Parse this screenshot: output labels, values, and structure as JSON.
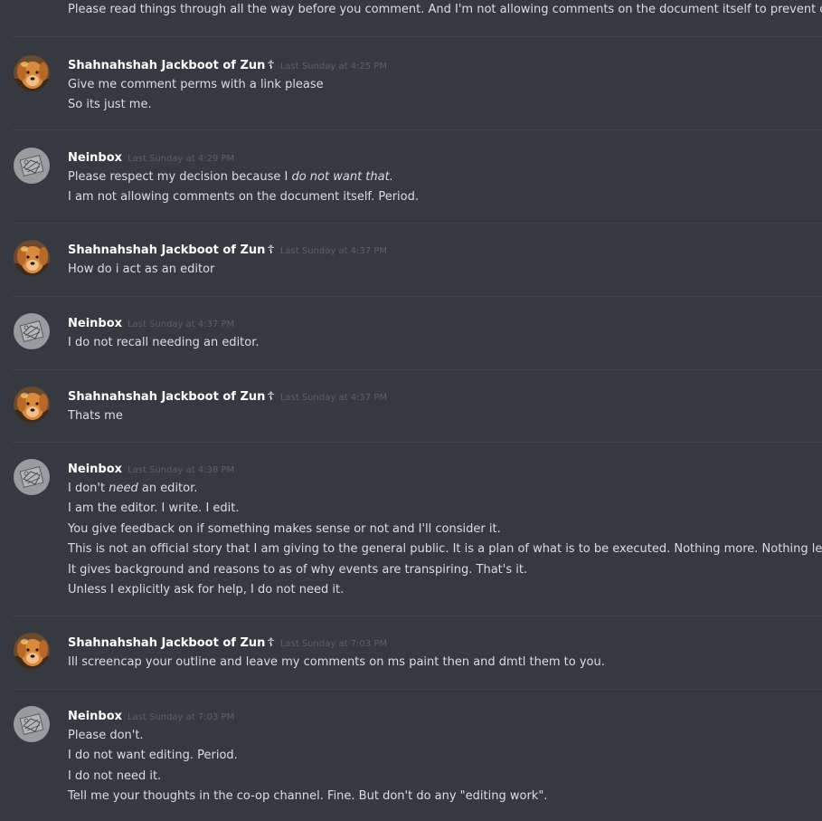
{
  "top_line": "Please read things through all the way before you comment. And I'm not allowing comments on the document itself to prevent clutter.",
  "messages": [
    {
      "username": "Shahnahshah Jackboot of Zun",
      "badge": "☦",
      "timestamp": "Last Sunday at 4:25 PM",
      "avatar": "dog-avatar-icon",
      "lines": [
        "Give me comment perms with a link please",
        "So its just me."
      ]
    },
    {
      "username": "Neinbox",
      "badge": "",
      "timestamp": "Last Sunday at 4:29 PM",
      "avatar": "sketch-avatar-icon",
      "lines": [
        {
          "pre": "Please respect my decision because I ",
          "em": "do not want that.",
          "post": ""
        },
        "I am not allowing comments on the document itself. Period."
      ]
    },
    {
      "username": "Shahnahshah Jackboot of Zun",
      "badge": "☦",
      "timestamp": "Last Sunday at 4:37 PM",
      "avatar": "dog-avatar-icon",
      "lines": [
        "How do i act as an editor"
      ]
    },
    {
      "username": "Neinbox",
      "badge": "",
      "timestamp": "Last Sunday at 4:37 PM",
      "avatar": "sketch-avatar-icon",
      "lines": [
        "I do not recall needing an editor."
      ]
    },
    {
      "username": "Shahnahshah Jackboot of Zun",
      "badge": "☦",
      "timestamp": "Last Sunday at 4:37 PM",
      "avatar": "dog-avatar-icon",
      "lines": [
        "Thats me"
      ]
    },
    {
      "username": "Neinbox",
      "badge": "",
      "timestamp": "Last Sunday at 4:38 PM",
      "avatar": "sketch-avatar-icon",
      "lines": [
        {
          "pre": "I don't ",
          "em": "need",
          "post": " an editor."
        },
        "I am the editor. I write. I edit.",
        "You give feedback on if something makes sense or not and I'll consider it.",
        "This is not an official story that I am giving to the general public. It is a plan of what is to be executed. Nothing more. Nothing less.",
        "It gives background and reasons to as of why events are transpiring. That's it.",
        "Unless I explicitly ask for help, I do not need it."
      ]
    },
    {
      "username": "Shahnahshah Jackboot of Zun",
      "badge": "☦",
      "timestamp": "Last Sunday at 7:03 PM",
      "avatar": "dog-avatar-icon",
      "lines": [
        "Ill screencap your outline and leave my comments on ms paint then and dmtl them to you."
      ]
    },
    {
      "username": "Neinbox",
      "badge": "",
      "timestamp": "Last Sunday at 7:03 PM",
      "avatar": "sketch-avatar-icon",
      "lines": [
        "Please don't.",
        "I do not want editing. Period.",
        "I do not need it.",
        "Tell me your thoughts in the co-op channel. Fine. But don't do any \"editing work\"."
      ]
    }
  ]
}
